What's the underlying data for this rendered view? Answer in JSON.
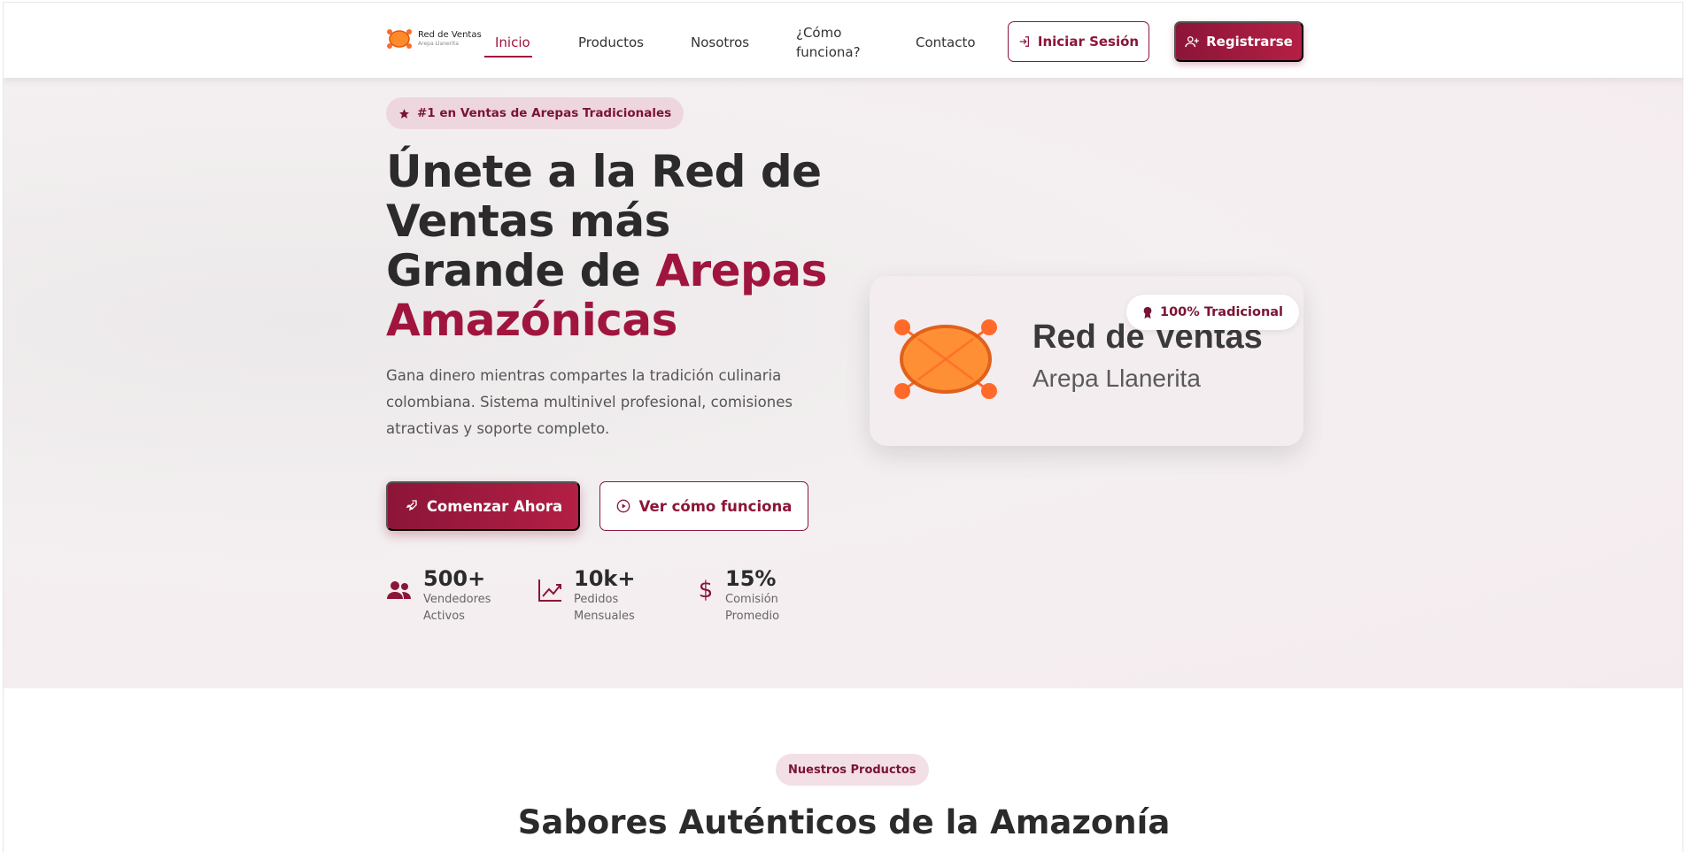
{
  "brand": {
    "title": "Red de Ventas",
    "subtitle": "Arepa Llanerita",
    "color_primary": "#8b1538",
    "color_accent": "#a0153e",
    "color_logo": "#ff8a2a"
  },
  "nav": {
    "items": [
      {
        "label": "Inicio",
        "active": true
      },
      {
        "label": "Productos"
      },
      {
        "label": "Nosotros"
      },
      {
        "label": "¿Cómo funciona?"
      },
      {
        "label": "Contacto"
      }
    ],
    "login_label": "Iniciar Sesión",
    "register_label": "Registrarse"
  },
  "hero": {
    "badge": "#1 en Ventas de Arepas Tradicionales",
    "title_part1": "Únete a la Red de Ventas más Grande de ",
    "title_accent": "Arepas Amazónicas",
    "description": "Gana dinero mientras compartes la tradición culinaria colombiana. Sistema multinivel profesional, comisiones atractivas y soporte completo.",
    "cta_primary": "Comenzar Ahora",
    "cta_secondary": "Ver cómo funciona",
    "stats": [
      {
        "value": "500+",
        "label": "Vendedores Activos",
        "icon": "users-icon"
      },
      {
        "value": "10k+",
        "label": "Pedidos Mensuales",
        "icon": "chart-line-icon"
      },
      {
        "value": "15%",
        "label": "Comisión Promedio",
        "icon": "dollar-icon"
      }
    ]
  },
  "card": {
    "badge": "100% Tradicional",
    "title": "Red de Ventas",
    "subtitle": "Arepa Llanerita"
  },
  "products": {
    "tag": "Nuestros Productos",
    "title": "Sabores Auténticos de la Amazonía"
  }
}
